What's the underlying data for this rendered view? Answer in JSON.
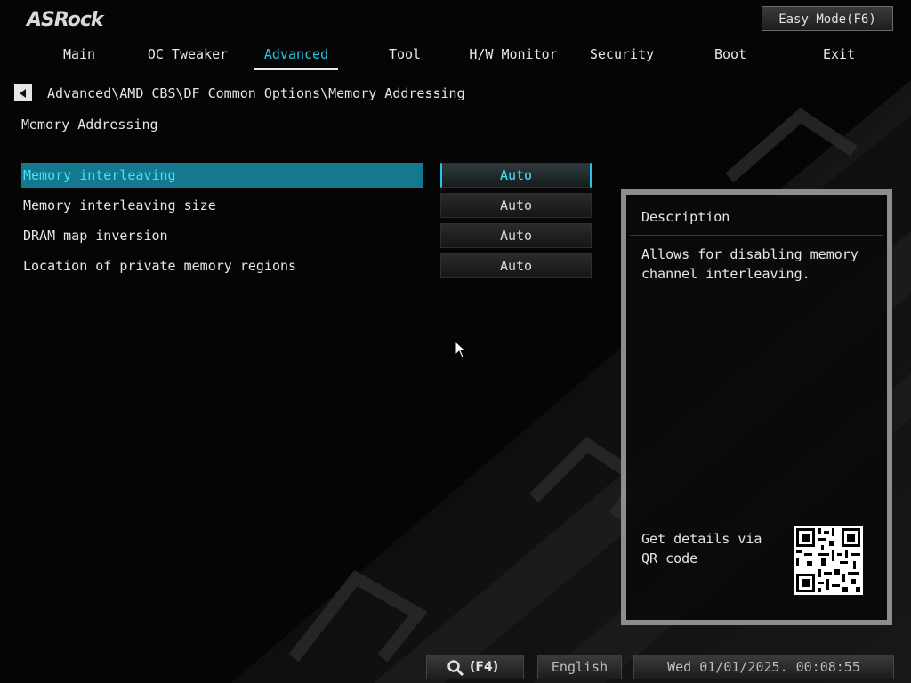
{
  "brand": {
    "logo": "ASRock"
  },
  "header": {
    "easy_mode_label": "Easy Mode(F6)"
  },
  "tabs": [
    {
      "label": "Main"
    },
    {
      "label": "OC Tweaker"
    },
    {
      "label": "Advanced",
      "active": true
    },
    {
      "label": "Tool"
    },
    {
      "label": "H/W Monitor"
    },
    {
      "label": "Security"
    },
    {
      "label": "Boot"
    },
    {
      "label": "Exit"
    }
  ],
  "breadcrumb": "Advanced\\AMD CBS\\DF Common Options\\Memory Addressing",
  "page_title": "Memory Addressing",
  "settings": [
    {
      "label": "Memory interleaving",
      "value": "Auto",
      "selected": true
    },
    {
      "label": "Memory interleaving size",
      "value": "Auto"
    },
    {
      "label": "DRAM map inversion",
      "value": "Auto"
    },
    {
      "label": "Location of private memory regions",
      "value": "Auto"
    }
  ],
  "description": {
    "title": "Description",
    "text": "Allows for disabling memory channel interleaving.",
    "qr_text": "Get details via QR code"
  },
  "footer": {
    "search_key": "(F4)",
    "language": "English",
    "datetime": "Wed 01/01/2025. 00:08:55"
  },
  "colors": {
    "accent": "#29c5e6",
    "selected_row": "#14798f",
    "background": "#050505"
  },
  "icons": {
    "back": "back-arrow-icon",
    "search": "magnifier-icon",
    "cursor": "mouse-pointer-icon",
    "qr": "qr-code-icon"
  }
}
